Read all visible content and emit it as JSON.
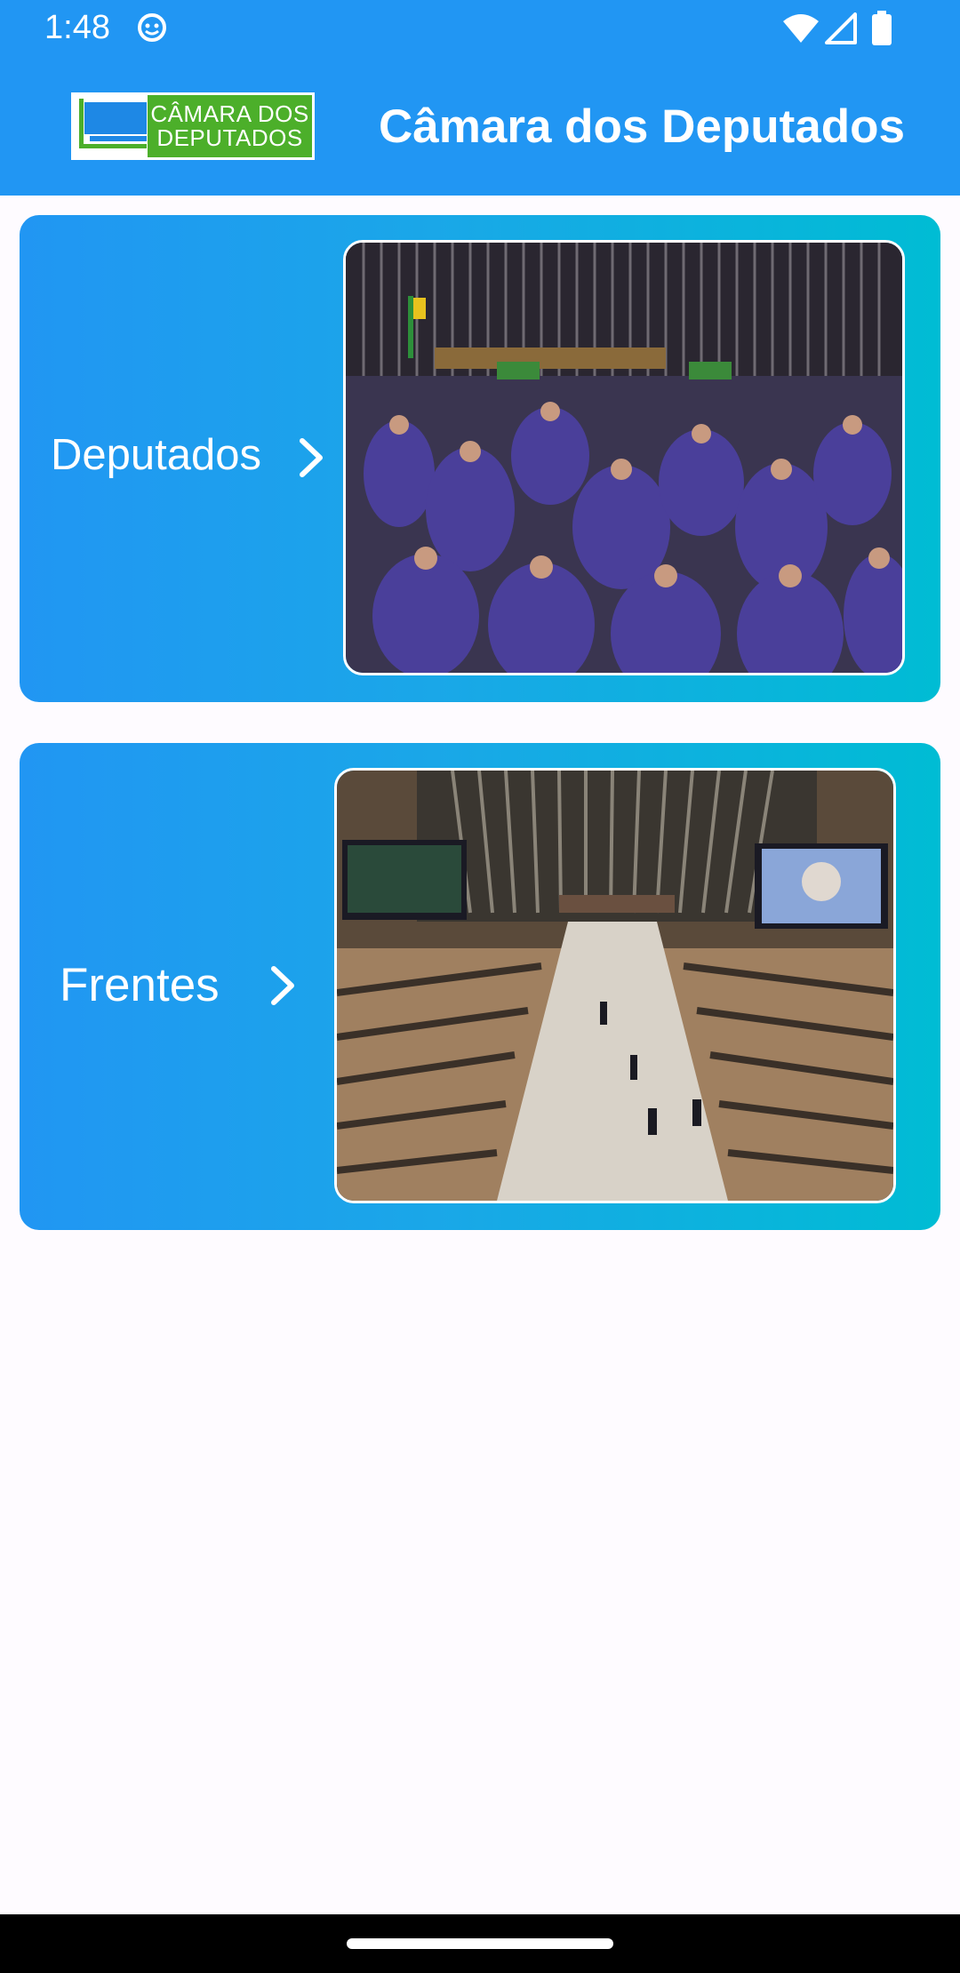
{
  "status_bar": {
    "time": "1:48",
    "icons": [
      "app-notification-icon",
      "wifi-icon",
      "signal-icon",
      "battery-icon"
    ]
  },
  "app_bar": {
    "logo_text": [
      "CÂMARA DOS",
      "DEPUTADOS"
    ],
    "title": "Câmara dos Deputados",
    "background_color": "#2196f3"
  },
  "cards": [
    {
      "label": "Deputados",
      "icon": "chevron-right-icon",
      "photo": "plenary-crowd-photo"
    },
    {
      "label": "Frentes",
      "icon": "chevron-right-icon",
      "photo": "plenary-chamber-photo"
    }
  ],
  "colors": {
    "card_gradient_start": "#2196f3",
    "card_gradient_end": "#00bcd4",
    "logo_green": "#4caf2a",
    "page_background": "#fefbff"
  }
}
